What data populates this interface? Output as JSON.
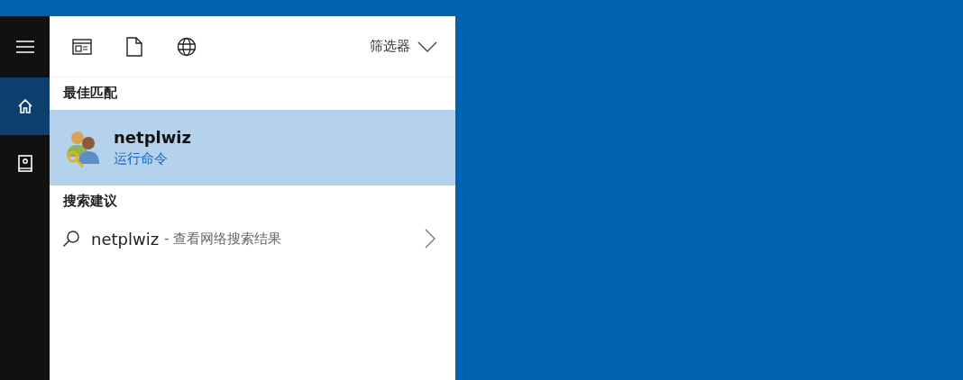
{
  "sidebar": {
    "items": [
      {
        "kind": "menu",
        "selected": false
      },
      {
        "kind": "home",
        "selected": true
      },
      {
        "kind": "notebook",
        "selected": false
      }
    ]
  },
  "toolbar": {
    "scopes": [
      {
        "kind": "apps"
      },
      {
        "kind": "documents"
      },
      {
        "kind": "web"
      }
    ],
    "filter": "筛选器"
  },
  "best_match": {
    "heading": "最佳匹配",
    "result": {
      "title": "netplwiz",
      "subtitle": "运行命令",
      "selected": true
    }
  },
  "suggestions": {
    "heading": "搜索建议",
    "items": [
      {
        "query": "netplwiz",
        "description": "- 查看网络搜索结果"
      }
    ]
  }
}
